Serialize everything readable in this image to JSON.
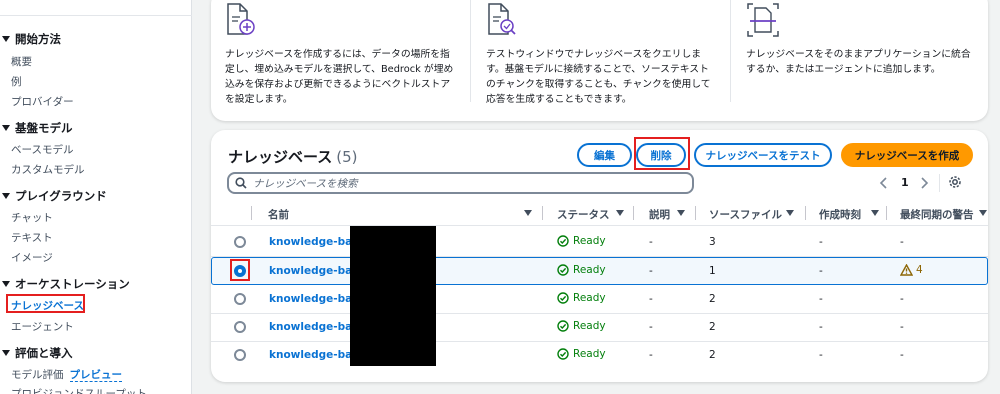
{
  "sidebar": {
    "sections": [
      {
        "title": "開始方法",
        "items": [
          "概要",
          "例",
          "プロバイダー"
        ]
      },
      {
        "title": "基盤モデル",
        "items": [
          "ベースモデル",
          "カスタムモデル"
        ]
      },
      {
        "title": "プレイグラウンド",
        "items": [
          "チャット",
          "テキスト",
          "イメージ"
        ]
      },
      {
        "title": "オーケストレーション",
        "items": [
          "ナレッジベース",
          "エージェント"
        ]
      },
      {
        "title": "評価と導入",
        "items": [
          "モデル評価"
        ]
      }
    ],
    "preview_badge": "プレビュー",
    "cutoff_item": "プロビジョンドスループット"
  },
  "info_cards": [
    {
      "icon": "document-add-icon",
      "text": "ナレッジベースを作成するには、データの場所を指定し、埋め込みモデルを選択して、Bedrock が埋め込みを保存および更新できるようにベクトルストアを設定します。"
    },
    {
      "icon": "document-search-icon",
      "text": "テストウィンドウでナレッジベースをクエリします。基盤モデルに接続することで、ソーステキストのチャンクを取得することも、チャンクを使用して応答を生成することもできます。"
    },
    {
      "icon": "document-scan-icon",
      "text": "ナレッジベースをそのままアプリケーションに統合するか、またはエージェントに追加します。"
    }
  ],
  "kb": {
    "title": "ナレッジベース",
    "count": "(5)",
    "buttons": {
      "edit": "編集",
      "delete": "削除",
      "test": "ナレッジベースをテスト",
      "create": "ナレッジベースを作成"
    },
    "search_placeholder": "ナレッジベースを検索",
    "page": "1",
    "columns": [
      "名前",
      "ステータス",
      "説明",
      "ソースファイル",
      "作成時刻",
      "最終同期の警告"
    ],
    "rows": [
      {
        "name": "knowledge-base-",
        "status": "Ready",
        "desc": "-",
        "files": "3",
        "created": "-",
        "warn": "-",
        "selected": false
      },
      {
        "name": "knowledge-base-",
        "status": "Ready",
        "desc": "-",
        "files": "1",
        "created": "-",
        "warn": "4",
        "selected": true
      },
      {
        "name": "knowledge-base-",
        "status": "Ready",
        "desc": "-",
        "files": "2",
        "created": "-",
        "warn": "-",
        "selected": false
      },
      {
        "name": "knowledge-base-",
        "status": "Ready",
        "desc": "-",
        "files": "2",
        "created": "-",
        "warn": "-",
        "selected": false
      },
      {
        "name": "knowledge-base-",
        "status": "Ready",
        "desc": "-",
        "files": "2",
        "created": "-",
        "warn": "-",
        "selected": false
      }
    ]
  },
  "colors": {
    "accent": "#0972d3",
    "primary": "#ff9900",
    "success": "#037f0c",
    "warning": "#8d6605",
    "highlight": "#e41f1f"
  }
}
